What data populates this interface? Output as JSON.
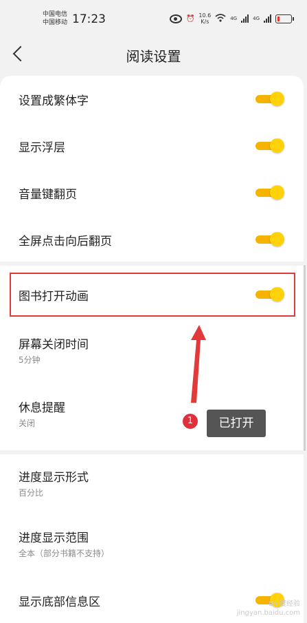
{
  "status_bar": {
    "carrier_1": "中国电信",
    "carrier_2": "中国移动",
    "time": "17:23",
    "speed_value": "10.6",
    "speed_unit": "K/s",
    "net_1": "4G",
    "net_2": "4G",
    "icons": [
      "eye-icon",
      "alarm-icon",
      "wifi-icon",
      "signal-icon",
      "signal-icon",
      "battery-icon"
    ]
  },
  "header": {
    "title": "阅读设置",
    "back_icon": "chevron-left-icon"
  },
  "settings_group_1": [
    {
      "label": "设置成繁体字",
      "enabled": true
    },
    {
      "label": "显示浮层",
      "enabled": true
    },
    {
      "label": "音量键翻页",
      "enabled": true
    },
    {
      "label": "全屏点击向后翻页",
      "enabled": true
    }
  ],
  "settings_group_2": {
    "book_animation": {
      "label": "图书打开动画",
      "enabled": true
    },
    "screen_timeout": {
      "label": "屏幕关闭时间",
      "value": "5分钟"
    },
    "rest_reminder": {
      "label": "休息提醒",
      "value": "关闭"
    }
  },
  "settings_group_3": {
    "progress_format": {
      "label": "进度显示形式",
      "value": "百分比"
    },
    "progress_range": {
      "label": "进度显示范围",
      "value": "全本（部分书籍不支持）"
    },
    "bottom_info": {
      "label": "显示底部信息区",
      "enabled": true
    }
  },
  "annotation": {
    "number": "1",
    "text": "已打开"
  },
  "watermark": {
    "brand": "Bai度经验",
    "url": "jingyan.baidu.com"
  },
  "colors": {
    "toggle_track": "#f5b300",
    "toggle_knob": "#ffd20a",
    "highlight": "#e23a3a",
    "badge": "#e0303a",
    "tooltip": "#555555",
    "background": "#f2f2f2"
  }
}
